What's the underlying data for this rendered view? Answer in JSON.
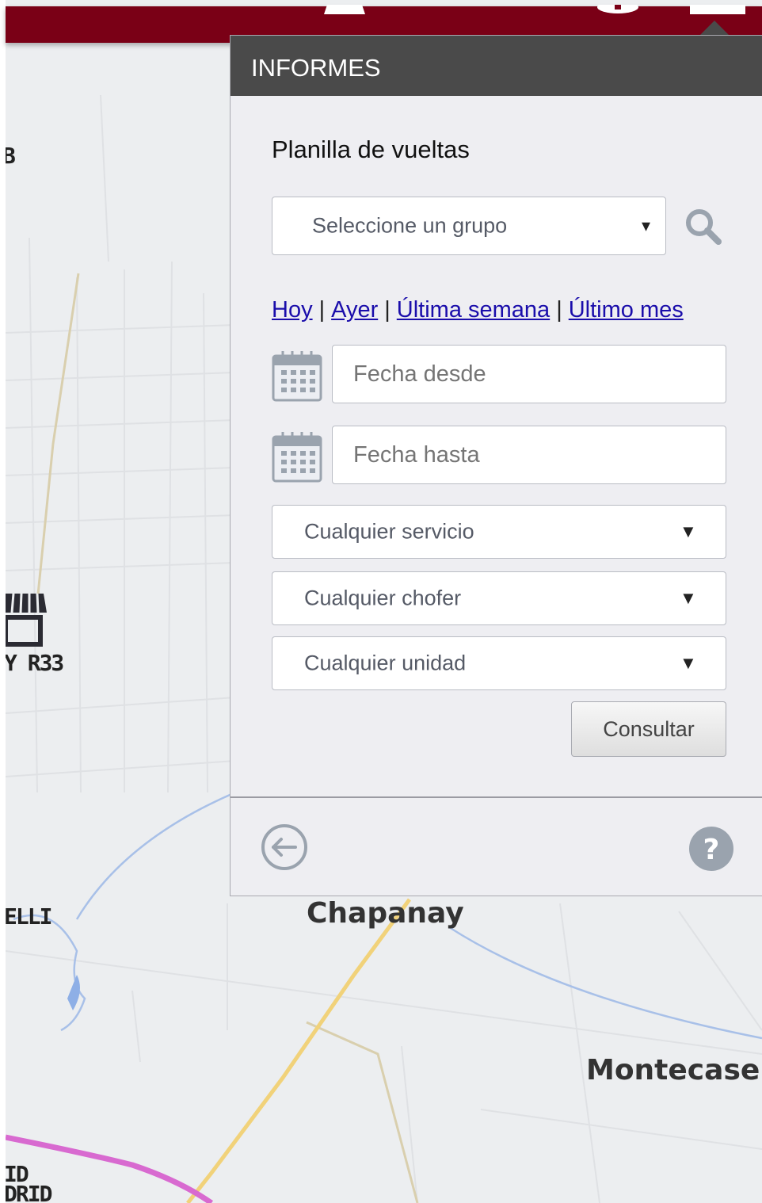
{
  "map": {
    "labels": {
      "fragment_b": "B",
      "route": "Y R33",
      "elli": "ELLI",
      "chapanay": "Chapanay",
      "montecasero": "Montecaser",
      "id": "ID",
      "drid": "DRID"
    }
  },
  "panel": {
    "header": "INFORMES",
    "title": "Planilla de vueltas",
    "group_select": {
      "value": "Seleccione un grupo",
      "arrow": "▾"
    },
    "quick_links": [
      "Hoy",
      "Ayer",
      "Última semana",
      "Último mes"
    ],
    "separator": "|",
    "date_from": {
      "placeholder": "Fecha desde"
    },
    "date_to": {
      "placeholder": "Fecha hasta"
    },
    "service_select": {
      "value": "Cualquier servicio",
      "arrow": "▼"
    },
    "driver_select": {
      "value": "Cualquier chofer",
      "arrow": "▼"
    },
    "unit_select": {
      "value": "Cualquier unidad",
      "arrow": "▼"
    },
    "submit_label": "Consultar"
  },
  "icons": {
    "search": "search-icon",
    "calendar": "calendar-icon",
    "back": "back-arrow-icon",
    "help": "help-icon",
    "store": "store-icon"
  },
  "colors": {
    "topbar": "#7a0016",
    "header": "#4a4a4a",
    "panel_bg": "#eeeef2",
    "link": "#1a0dab",
    "icon_gray": "#9aa3ae"
  }
}
